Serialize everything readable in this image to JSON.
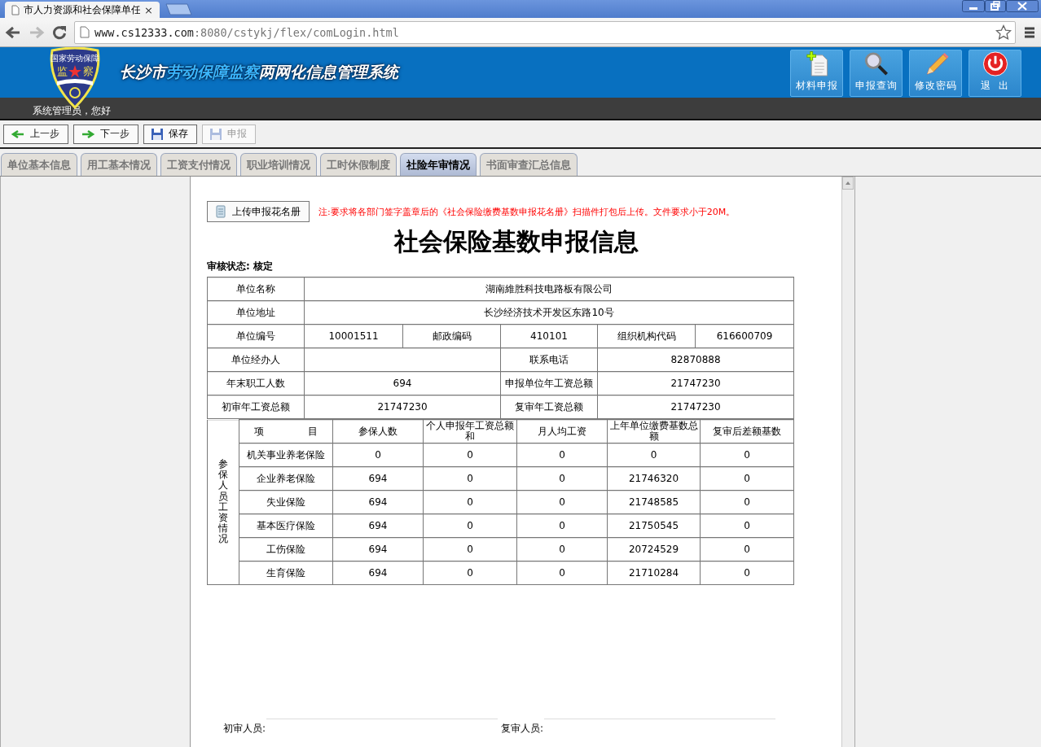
{
  "browser": {
    "tab_title": "市人力资源和社会保障单任",
    "tab_close": "×",
    "url_host": "www.cs12333.com",
    "url_path": ":8080/cstykj/flex/comLogin.html"
  },
  "header": {
    "logo_arc": "国家劳动保障",
    "logo_left": "监",
    "logo_right": "察",
    "title_prefix": "长沙市",
    "title_highlight": "劳动保障监察",
    "title_suffix": "两网化信息管理系统",
    "nav": [
      {
        "label": "材料申报"
      },
      {
        "label": "申报查询"
      },
      {
        "label": "修改密码"
      },
      {
        "label": "退  出"
      }
    ],
    "greeting": "系统管理员，您好"
  },
  "toolbar": [
    {
      "label": "上一步",
      "disabled": false
    },
    {
      "label": "下一步",
      "disabled": false
    },
    {
      "label": "保存",
      "disabled": false
    },
    {
      "label": "申报",
      "disabled": true
    }
  ],
  "tabs": [
    {
      "label": "单位基本信息",
      "selected": false
    },
    {
      "label": "用工基本情况",
      "selected": false
    },
    {
      "label": "工资支付情况",
      "selected": false
    },
    {
      "label": "职业培训情况",
      "selected": false
    },
    {
      "label": "工时休假制度",
      "selected": false
    },
    {
      "label": "社险年审情况",
      "selected": true
    },
    {
      "label": "书面审查汇总信息",
      "selected": false
    }
  ],
  "document": {
    "upload_button": "上传申报花名册",
    "note": "注:要求将各部门签字盖章后的《社会保险缴费基数申报花名册》扫描件打包后上传。文件要求小于20M。",
    "heading": "社会保险基数申报信息",
    "status_label": "审核状态:",
    "status_value": "核定",
    "info_rows": [
      {
        "kind": "full",
        "cells": [
          "单位名称",
          "湖南維胜科技电路板有限公司"
        ]
      },
      {
        "kind": "full",
        "cells": [
          "单位地址",
          "长沙经济技术开发区东路10号"
        ]
      },
      {
        "kind": "triple",
        "cells": [
          "单位编号",
          "10001511",
          "邮政编码",
          "410101",
          "组织机构代码",
          "616600709"
        ]
      },
      {
        "kind": "pair",
        "cells": [
          "单位经办人",
          "",
          "联系电话",
          "82870888"
        ]
      },
      {
        "kind": "pair",
        "cells": [
          "年末职工人数",
          "694",
          "申报单位年工资总额",
          "21747230"
        ]
      },
      {
        "kind": "pair",
        "cells": [
          "初审年工资总额",
          "21747230",
          "复审年工资总额",
          "21747230"
        ]
      }
    ],
    "side_label": "参保人员工资情况",
    "item_header_left": "项",
    "item_header_right": "目",
    "columns": [
      "参保人数",
      "个人申报年工资总额和",
      "月人均工资",
      "上年单位缴费基数总额",
      "复审后差额基数"
    ],
    "items": [
      {
        "name": "机关事业养老保险",
        "values": [
          "0",
          "0",
          "0",
          "0",
          "0"
        ]
      },
      {
        "name": "企业养老保险",
        "values": [
          "694",
          "0",
          "0",
          "21746320",
          "0"
        ]
      },
      {
        "name": "失业保险",
        "values": [
          "694",
          "0",
          "0",
          "21748585",
          "0"
        ]
      },
      {
        "name": "基本医疗保险",
        "values": [
          "694",
          "0",
          "0",
          "21750545",
          "0"
        ]
      },
      {
        "name": "工伤保险",
        "values": [
          "694",
          "0",
          "0",
          "20724529",
          "0"
        ]
      },
      {
        "name": "生育保险",
        "values": [
          "694",
          "0",
          "0",
          "21710284",
          "0"
        ]
      }
    ],
    "signatures": [
      "初审人员:",
      "复审人员:"
    ]
  }
}
